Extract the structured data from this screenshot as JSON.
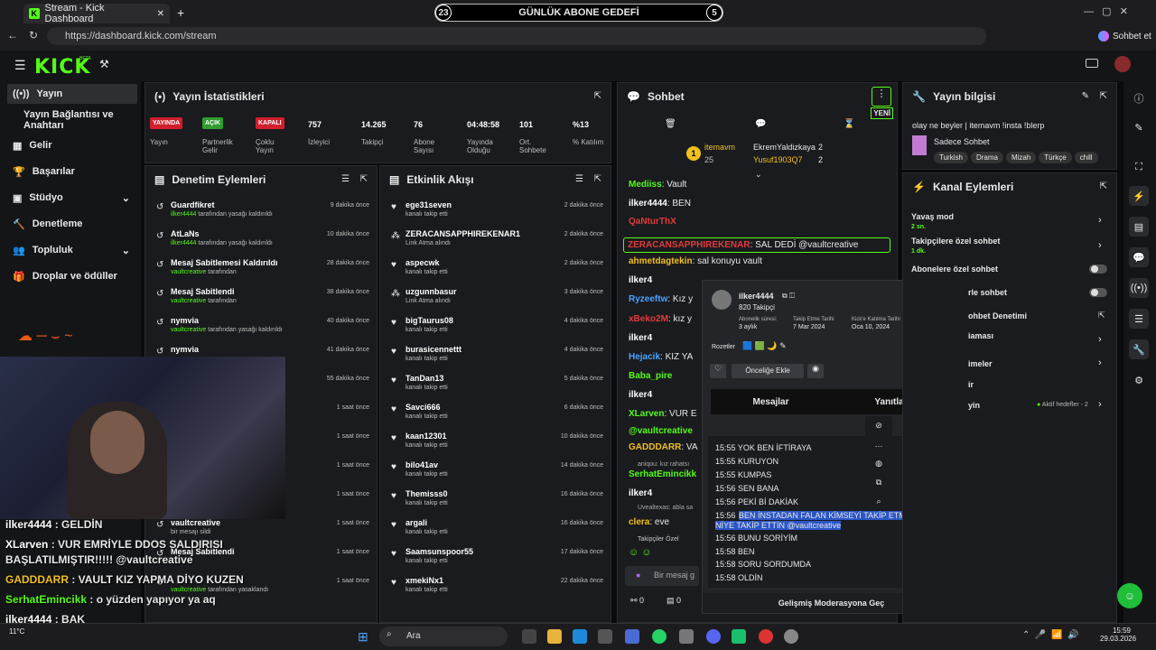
{
  "browser": {
    "tab_title": "Stream - Kick Dashboard",
    "url": "https://dashboard.kick.com/stream",
    "profile_label": "Sohbet et"
  },
  "goal": {
    "left": "23",
    "title": "GÜNLÜK ABONE GEDEFİ",
    "right": "5"
  },
  "logo": "KICK",
  "logo_beta": "BETA",
  "sidebar": {
    "items": [
      "Yayın",
      "Yayın Bağlantısı ve Anahtarı",
      "Gelir",
      "Başarılar",
      "Stüdyo",
      "Denetleme",
      "Topluluk",
      "Droplar ve ödüller"
    ]
  },
  "stats": {
    "title": "Yayın İstatistikleri",
    "items": [
      {
        "value": "YAYINDA",
        "label": "Yayın"
      },
      {
        "value": "AÇIK",
        "label": "Partnerlik Gelir"
      },
      {
        "value": "KAPALI",
        "label": "Çoklu Yayın"
      },
      {
        "value": "757",
        "label": "İzleyici"
      },
      {
        "value": "14.265",
        "label": "Takipçi"
      },
      {
        "value": "76",
        "label": "Abone Sayısı"
      },
      {
        "value": "04:48:58",
        "label": "Yayında Olduğu"
      },
      {
        "value": "101",
        "label": "Ort. Sohbete"
      },
      {
        "value": "%13",
        "label": "% Katılım"
      }
    ]
  },
  "moderation": {
    "title": "Denetim Eylemleri",
    "items": [
      {
        "user": "Guardfikret",
        "actor": "ilker4444",
        "action": "tarafından yasağı kaldırıldı",
        "time": "9 dakika önce"
      },
      {
        "user": "AtLaNs",
        "actor": "ilker4444",
        "action": "tarafından yasağı kaldırıldı",
        "time": "10 dakika önce"
      },
      {
        "user": "Mesaj Sabitlemesi Kaldırıldı",
        "actor": "vaultcreative",
        "action": "tarafından",
        "time": "28 dakika önce"
      },
      {
        "user": "Mesaj Sabitlendi",
        "actor": "vaultcreative",
        "action": "tarafından",
        "time": "38 dakika önce"
      },
      {
        "user": "nymvia",
        "actor": "vaultcreative",
        "action": "tarafından yasağı kaldırıldı",
        "time": "40 dakika önce"
      },
      {
        "user": "nymvia",
        "actor": "",
        "action": "",
        "time": "41 dakika önce"
      },
      {
        "user": "",
        "actor": "",
        "action": "",
        "time": "55 dakika önce"
      },
      {
        "user": "",
        "actor": "",
        "action": "",
        "time": "1 saat önce"
      },
      {
        "user": "",
        "actor": "",
        "action": "",
        "time": "1 saat önce"
      },
      {
        "user": "",
        "actor": "",
        "action": "",
        "time": "1 saat önce"
      },
      {
        "user": "",
        "actor": "",
        "action": "",
        "time": "1 saat önce"
      },
      {
        "user": "vaultcreative",
        "actor": "",
        "action": "bir mesajı sildi",
        "time": "1 saat önce"
      },
      {
        "user": "Mesaj Sabitlendi",
        "actor": "",
        "action": "",
        "time": "1 saat önce"
      },
      {
        "user": "",
        "actor": "vaultcreative",
        "action": "tarafından yasaklandı",
        "time": "1 saat önce"
      }
    ]
  },
  "activity": {
    "title": "Etkinlik Akışı",
    "items": [
      {
        "user": "ege31seven",
        "sub": "kanalı takip etti",
        "time": "2 dakika önce",
        "icon": "heart"
      },
      {
        "user": "ZERACANSAPPHIREKENAR1",
        "sub": "Link Atma alındı",
        "time": "2 dakika önce",
        "icon": "dots"
      },
      {
        "user": "aspecwk",
        "sub": "kanalı takip etti",
        "time": "2 dakika önce",
        "icon": "heart"
      },
      {
        "user": "uzgunnbasur",
        "sub": "Link Atma alındı",
        "time": "3 dakika önce",
        "icon": "dots"
      },
      {
        "user": "bigTaurus08",
        "sub": "kanalı takip etti",
        "time": "4 dakika önce",
        "icon": "heart"
      },
      {
        "user": "burasicennettt",
        "sub": "kanalı takip etti",
        "time": "4 dakika önce",
        "icon": "heart"
      },
      {
        "user": "TanDan13",
        "sub": "kanalı takip etti",
        "time": "5 dakika önce",
        "icon": "heart"
      },
      {
        "user": "Savci666",
        "sub": "kanalı takip etti",
        "time": "6 dakika önce",
        "icon": "heart"
      },
      {
        "user": "kaan12301",
        "sub": "kanalı takip etti",
        "time": "10 dakika önce",
        "icon": "heart"
      },
      {
        "user": "bilo41av",
        "sub": "kanalı takip etti",
        "time": "14 dakika önce",
        "icon": "heart"
      },
      {
        "user": "Themisss0",
        "sub": "kanalı takip etti",
        "time": "16 dakika önce",
        "icon": "heart"
      },
      {
        "user": "argali",
        "sub": "kanalı takip etti",
        "time": "16 dakika önce",
        "icon": "heart"
      },
      {
        "user": "Saamsunspoor55",
        "sub": "kanalı takip etti",
        "time": "17 dakika önce",
        "icon": "heart"
      },
      {
        "user": "xmekiNx1",
        "sub": "kanalı takip etti",
        "time": "22 dakika önce",
        "icon": "heart"
      }
    ]
  },
  "chat": {
    "title": "Sohbet",
    "new_label": "YENİ",
    "pinned": {
      "user": "itemavm",
      "count": "25",
      "rank": "1",
      "user2": "EkremYaldizkaya",
      "n2": "2",
      "user3": "Yusuf1903Q7",
      "n3": "2"
    },
    "lines": [
      {
        "user": "Mediiss",
        "color": "#53fc18",
        "text": "Vault"
      },
      {
        "user": "ilker4444",
        "color": "#ffffff",
        "text": "BEN"
      },
      {
        "user": "QaNturThX",
        "color": "#e23b3b",
        "text": ""
      },
      {
        "user": "ZERACANSAPPHIREKENAR",
        "color": "#e23b3b",
        "text": "SAL DEDİ @vaultcreative"
      },
      {
        "user": "ahmetdagtekin",
        "color": "#f0c020",
        "text": "sal konuyu vault"
      },
      {
        "user": "ilker4",
        "color": "#ffffff",
        "text": ""
      },
      {
        "user": "Ryzeeftw",
        "color": "#4ba3ff",
        "text": "Kız y"
      },
      {
        "user": "xBeko2M",
        "color": "#e23b3b",
        "text": "kız y"
      },
      {
        "user": "ilker4",
        "color": "#ffffff",
        "text": ""
      },
      {
        "user": "Hejacik",
        "color": "#4ba3ff",
        "text": "KIZ YA"
      },
      {
        "user": "Baba_pire",
        "color": "#53fc18",
        "text": ""
      },
      {
        "user": "ilker4",
        "color": "#ffffff",
        "text": ""
      },
      {
        "user": "XLarven",
        "color": "#53fc18",
        "text": "VUR E"
      },
      {
        "user": "@vaultcreative",
        "color": "#53fc18",
        "text": ""
      },
      {
        "user": "GADDDARR",
        "color": "#f0c020",
        "text": "VA"
      },
      {
        "user": "SerhatEmincikk",
        "color": "#53fc18",
        "text": ""
      },
      {
        "user": "ilker4",
        "color": "#ffffff",
        "text": ""
      },
      {
        "user": "clera",
        "color": "#f0c020",
        "text": "eve"
      }
    ],
    "reply_hint": "aniqou: kız rahatsı",
    "reply_hint2": "Uvealtexas: abla sa",
    "followers_only": "Takipçiler Özel",
    "input_placeholder": "Bir mesaj g",
    "footer_viewers": "0",
    "footer_count": "0"
  },
  "user_card": {
    "name": "ilker4444",
    "followers": "820 Takipçi",
    "sub_label": "Abonelik süresi:",
    "sub_value": "3 aylık",
    "follow_label": "Takip Etme Tarihi",
    "follow_value": "7 Mar 2024",
    "join_label": "Kick'e Katılma Tarihi",
    "join_value": "Oca 10, 2024",
    "badges_label": "Rozetler",
    "priority_btn": "Önceliğe Ekle",
    "tab_messages": "Mesajlar",
    "tab_replies": "Yanıtlar",
    "messages": [
      "15:55 YOK BEN İFTİRAYA",
      "15:55 KURUYON",
      "15:55 KUMPAS",
      "15:56 SEN BANA",
      "15:56 PEKİ Bİ DAKİAK",
      "15:56",
      "BEN İNSTADAN FALAN KİMSEYİ TAKİP ETMEDİM SEN",
      "NİYE TAKİP ETTİN @vaultcreative",
      "15:56 BUNU SORİYİM",
      "15:58 BEN",
      "15:58 SORU SORDUMDA",
      "15:58 OLDİN"
    ],
    "advanced_btn": "Gelişmiş Moderasyona Geç"
  },
  "stream_info": {
    "title": "Yayın bilgisi",
    "stream_title": "olay ne beyler | itemavm !insta !blerp",
    "category": "Sadece Sohbet",
    "tags": [
      "Turkish",
      "Drama",
      "Mizah",
      "Türkçe",
      "chill"
    ]
  },
  "channel_actions": {
    "title": "Kanal Eylemleri",
    "items": [
      {
        "label": "Yavaş mod",
        "sub": "2 sn."
      },
      {
        "label": "Takipçilere özel sohbet",
        "sub": "1 dk."
      },
      {
        "label": "Abonelere özel sohbet",
        "sub": ""
      },
      {
        "label": "rle sohbet",
        "sub": ""
      },
      {
        "label": "ohbet Denetimi",
        "sub": ""
      },
      {
        "label": "iaması",
        "sub": ""
      },
      {
        "label": "imeler",
        "sub": ""
      },
      {
        "label": "ir",
        "sub": ""
      },
      {
        "label": "yin",
        "sub": "Aktif hedefler - 2"
      }
    ]
  },
  "overlay_chat": [
    {
      "user": "ilker4444",
      "text": " : GELDİN",
      "color": "#ffffff"
    },
    {
      "user": "XLarven",
      "text": " : VUR EMRİYLE DDOS SALDIRISI",
      "color": "#ffffff"
    },
    {
      "user": "",
      "text": "BAŞLATILMIŞTIR!!!!! @vaultcreative",
      "color": "#ffffff"
    },
    {
      "user": "GADDDARR",
      "text": " : VAULT KIZ YAPMA DİYO KUZEN",
      "color": "#f0c020"
    },
    {
      "user": "SerhatEmincikk",
      "text": " : o yüzden yapıyor ya aq",
      "color": "#53fc18"
    },
    {
      "user": "ilker4444",
      "text": " : BAK",
      "color": "#ffffff"
    },
    {
      "user": "clera",
      "text": " : evet",
      "color": "#f0c020"
    }
  ],
  "taskbar": {
    "search": "Ara",
    "time": "15:59",
    "date": "29.03.2026",
    "weather": "11°C"
  }
}
